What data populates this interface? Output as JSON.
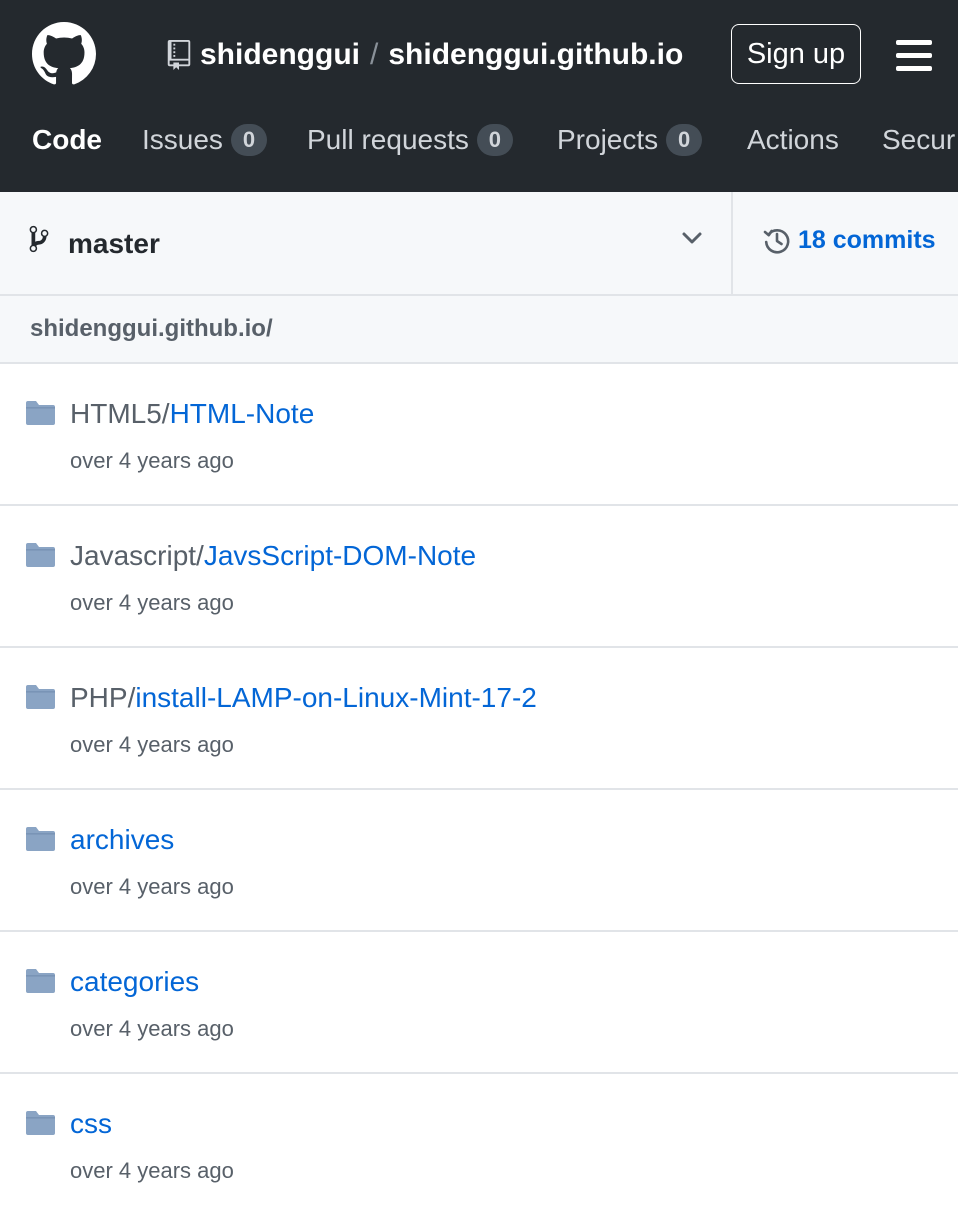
{
  "header": {
    "logo_icon": "github-mark-icon",
    "repo_icon": "repo-icon",
    "owner": "shidenggui",
    "separator": "/",
    "repo": "shidenggui.github.io",
    "signup_label": "Sign up",
    "menu_icon": "hamburger-menu-icon"
  },
  "nav": [
    {
      "label": "Code",
      "active": true
    },
    {
      "label": "Issues",
      "count": "0"
    },
    {
      "label": "Pull requests",
      "count": "0"
    },
    {
      "label": "Projects",
      "count": "0"
    },
    {
      "label": "Actions"
    },
    {
      "label": "Secur"
    }
  ],
  "branch": {
    "icon": "git-branch-icon",
    "name": "master",
    "dropdown_icon": "chevron-down-icon",
    "commits_icon": "history-icon",
    "commits_label": "18 commits"
  },
  "path": {
    "text": "shidenggui.github.io/"
  },
  "files": [
    {
      "icon": "folder-icon",
      "prefix": "HTML5/",
      "name": "HTML-Note",
      "age": "over 4 years ago"
    },
    {
      "icon": "folder-icon",
      "prefix": "Javascript/",
      "name": "JavsScript-DOM-Note",
      "age": "over 4 years ago"
    },
    {
      "icon": "folder-icon",
      "prefix": "PHP/",
      "name": "install-LAMP-on-Linux-Mint-17-2",
      "age": "over 4 years ago"
    },
    {
      "icon": "folder-icon",
      "prefix": "",
      "name": "archives",
      "age": "over 4 years ago"
    },
    {
      "icon": "folder-icon",
      "prefix": "",
      "name": "categories",
      "age": "over 4 years ago"
    },
    {
      "icon": "folder-icon",
      "prefix": "",
      "name": "css",
      "age": "over 4 years ago"
    }
  ],
  "colors": {
    "header_bg": "#24292e",
    "link": "#0366d6",
    "muted": "#586069",
    "folder": "#79b8ff"
  }
}
